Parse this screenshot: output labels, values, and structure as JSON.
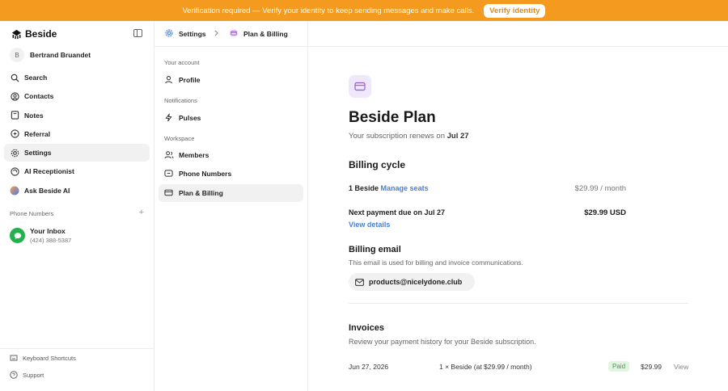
{
  "banner": {
    "message": "Verification required — Verify your identity to keep sending messages and make calls.",
    "button": "Verify identity"
  },
  "brand": {
    "name": "Beside"
  },
  "user": {
    "initial": "B",
    "name": "Bertrand Bruandet"
  },
  "nav": {
    "items": [
      {
        "label": "Search",
        "icon": "search-icon"
      },
      {
        "label": "Contacts",
        "icon": "contacts-icon"
      },
      {
        "label": "Notes",
        "icon": "notes-icon"
      },
      {
        "label": "Referral",
        "icon": "referral-icon"
      },
      {
        "label": "Settings",
        "icon": "gear-icon"
      },
      {
        "label": "AI Receptionist",
        "icon": "receptionist-icon"
      },
      {
        "label": "Ask Beside AI",
        "icon": "beside-ai-icon"
      }
    ]
  },
  "phone_numbers": {
    "header": "Phone Numbers",
    "add": "+",
    "inbox_title": "Your Inbox",
    "inbox_number": "(424) 388-5387"
  },
  "bottom": {
    "shortcuts": "Keyboard Shortcuts",
    "support": "Support"
  },
  "breadcrumb": {
    "settings": "Settings",
    "current": "Plan & Billing"
  },
  "settings_menu": {
    "your_account": "Your account",
    "profile": "Profile",
    "notifications": "Notifications",
    "pulses": "Pulses",
    "workspace": "Workspace",
    "members": "Members",
    "phone_numbers": "Phone Numbers",
    "plan_billing": "Plan & Billing"
  },
  "plan": {
    "title": "Beside Plan",
    "renew_text": "Your subscription renews on",
    "renew_date": "Jul 27"
  },
  "billing_cycle": {
    "heading": "Billing cycle",
    "seat_label": "1 Beside",
    "manage_link": "Manage seats",
    "price": "$29.99 / month",
    "next_payment_label": "Next payment due on Jul 27",
    "next_payment_amount": "$29.99 USD",
    "view_details": "View details"
  },
  "billing_email": {
    "heading": "Billing email",
    "description": "This email is used for billing and invoice communications.",
    "email": "products@nicelydone.club"
  },
  "invoices": {
    "heading": "Invoices",
    "description": "Review your payment history for your Beside subscription.",
    "rows": [
      {
        "date": "Jun 27, 2026",
        "item": "1 × Beside (at $29.99 / month)",
        "status": "Paid",
        "amount": "$29.99",
        "action": "View"
      }
    ]
  },
  "colors": {
    "banner": "#f39a1f",
    "link": "#4a7ddb",
    "paid_text": "#43a047",
    "plan_icon_bg": "#efe7fb",
    "inbox_green": "#22b14c"
  }
}
